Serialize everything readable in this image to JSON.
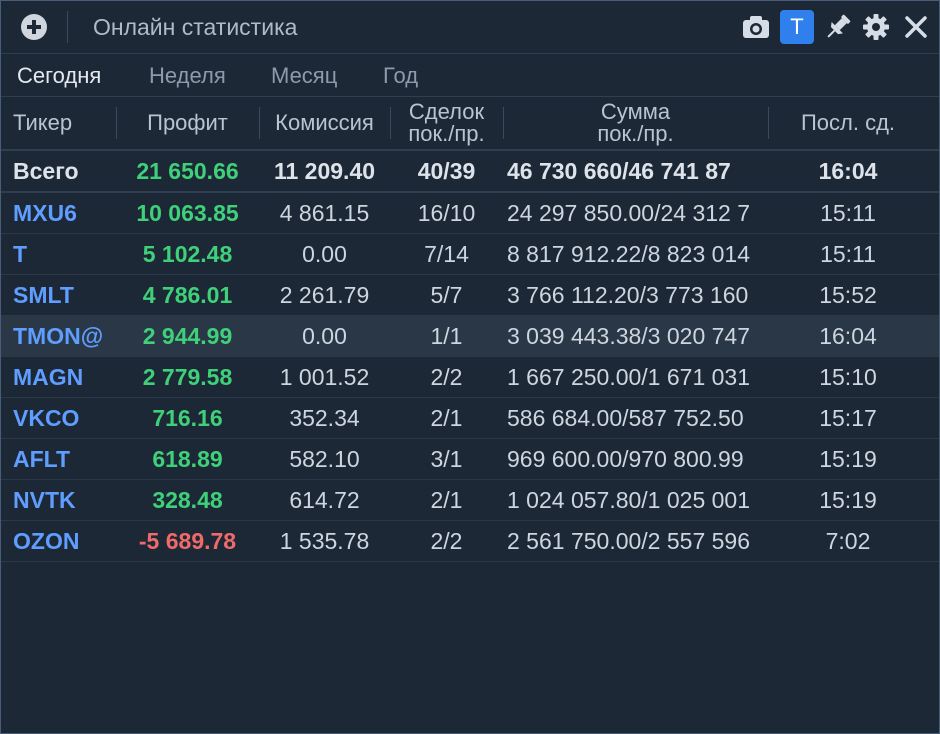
{
  "window": {
    "title": "Онлайн статистика",
    "t_button": "T"
  },
  "tabs": [
    "Сегодня",
    "Неделя",
    "Месяц",
    "Год"
  ],
  "active_tab": "Сегодня",
  "table": {
    "headers": {
      "ticker": "Тикер",
      "profit": "Профит",
      "commission": "Комиссия",
      "deals_line1": "Сделок",
      "deals_line2": "пок./пр.",
      "sum_line1": "Сумма",
      "sum_line2": "пок./пр.",
      "last": "Посл. сд."
    },
    "total": {
      "ticker": "Всего",
      "profit": "21 650.66",
      "commission": "11 209.40",
      "deals": "40/39",
      "sum": "46 730 660/46 741 87",
      "last": "16:04"
    },
    "rows": [
      {
        "ticker": "MXU6",
        "profit": "10 063.85",
        "commission": "4 861.15",
        "deals": "16/10",
        "sum": "24 297 850.00/24 312 7",
        "last": "15:11"
      },
      {
        "ticker": "T",
        "profit": "5 102.48",
        "commission": "0.00",
        "deals": "7/14",
        "sum": "8 817 912.22/8 823 014",
        "last": "15:11"
      },
      {
        "ticker": "SMLT",
        "profit": "4 786.01",
        "commission": "2 261.79",
        "deals": "5/7",
        "sum": "3 766 112.20/3 773 160",
        "last": "15:52"
      },
      {
        "ticker": "TMON@",
        "profit": "2 944.99",
        "commission": "0.00",
        "deals": "1/1",
        "sum": "3 039 443.38/3 020 747",
        "last": "16:04"
      },
      {
        "ticker": "MAGN",
        "profit": "2 779.58",
        "commission": "1 001.52",
        "deals": "2/2",
        "sum": "1 667 250.00/1 671 031",
        "last": "15:10"
      },
      {
        "ticker": "VKCO",
        "profit": "716.16",
        "commission": "352.34",
        "deals": "2/1",
        "sum": "586 684.00/587 752.50",
        "last": "15:17"
      },
      {
        "ticker": "AFLT",
        "profit": "618.89",
        "commission": "582.10",
        "deals": "3/1",
        "sum": "969 600.00/970 800.99",
        "last": "15:19"
      },
      {
        "ticker": "NVTK",
        "profit": "328.48",
        "commission": "614.72",
        "deals": "2/1",
        "sum": "1 024 057.80/1 025 001",
        "last": "15:19"
      },
      {
        "ticker": "OZON",
        "profit": "-5 689.78",
        "commission": "1 535.78",
        "deals": "2/2",
        "sum": "2 561 750.00/2 557 596",
        "last": "7:02"
      }
    ],
    "selected_row": 3
  },
  "colors": {
    "background": "#1d2836",
    "ticker": "#5f9dff",
    "profit_positive": "#3fd17a",
    "profit_negative": "#f06a6a",
    "accent_button": "#2f80ed"
  },
  "icons": [
    "add-circle-icon",
    "camera-icon",
    "pin-icon",
    "gear-icon",
    "close-icon"
  ]
}
